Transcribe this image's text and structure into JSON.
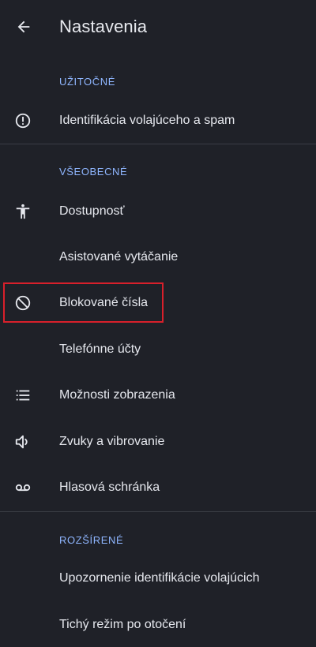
{
  "app_bar": {
    "title": "Nastavenia",
    "back_icon": "arrow-back-icon"
  },
  "sections": {
    "useful": {
      "header": "UŽITOČNÉ",
      "items": [
        {
          "label": "Identifikácia volajúceho a spam",
          "icon": "info-alert-icon"
        }
      ]
    },
    "general": {
      "header": "VŠEOBECNÉ",
      "items": [
        {
          "label": "Dostupnosť",
          "icon": "accessibility-icon"
        },
        {
          "label": "Asistované vytáčanie",
          "icon": ""
        },
        {
          "label": "Blokované čísla",
          "icon": "block-icon"
        },
        {
          "label": "Telefónne účty",
          "icon": ""
        },
        {
          "label": "Možnosti zobrazenia",
          "icon": "list-icon"
        },
        {
          "label": "Zvuky a vibrovanie",
          "icon": "volume-icon"
        },
        {
          "label": "Hlasová schránka",
          "icon": "voicemail-icon"
        }
      ]
    },
    "advanced": {
      "header": "ROZŠÍRENÉ",
      "items": [
        {
          "label": "Upozornenie identifikácie volajúcich",
          "icon": ""
        },
        {
          "label": "Tichý režim po otočení",
          "icon": ""
        }
      ]
    }
  },
  "colors": {
    "background": "#1f2128",
    "section_header": "#8fb6ff",
    "text": "#e6e8ee",
    "divider": "#3a3d45",
    "highlight_border": "#d8202b"
  }
}
